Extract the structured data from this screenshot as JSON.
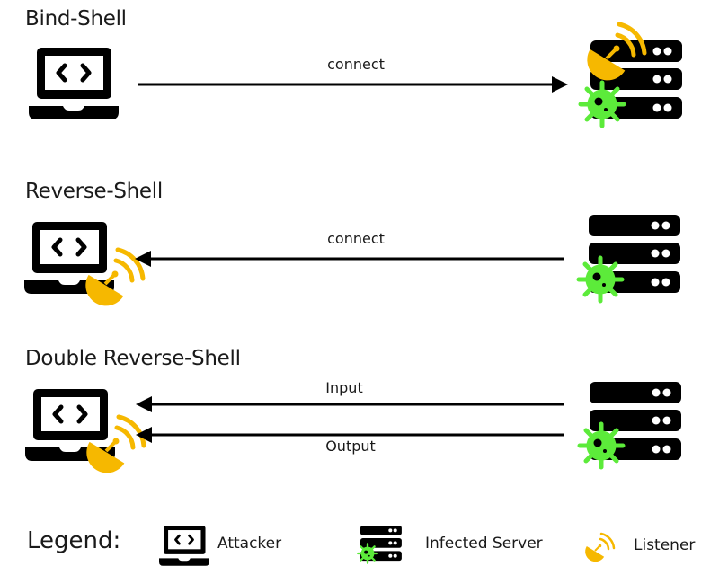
{
  "colors": {
    "ink": "#000000",
    "listener": "#F6B800",
    "infection": "#5CEB3A",
    "background": "#FFFFFF"
  },
  "sections": [
    {
      "title": "Bind-Shell",
      "arrows": [
        {
          "label": "connect",
          "direction": "attacker-to-server"
        }
      ],
      "attacker_has_listener": false,
      "server_has_listener": true
    },
    {
      "title": "Reverse-Shell",
      "arrows": [
        {
          "label": "connect",
          "direction": "server-to-attacker"
        }
      ],
      "attacker_has_listener": true,
      "server_has_listener": false
    },
    {
      "title": "Double Reverse-Shell",
      "arrows": [
        {
          "label": "Input",
          "direction": "server-to-attacker"
        },
        {
          "label": "Output",
          "direction": "server-to-attacker"
        }
      ],
      "attacker_has_listener": true,
      "server_has_listener": false
    }
  ],
  "legend": {
    "title": "Legend:",
    "items": [
      {
        "icon": "laptop-code-icon",
        "label": "Attacker"
      },
      {
        "icon": "infected-server-icon",
        "label": "Infected Server"
      },
      {
        "icon": "satellite-dish-icon",
        "label": "Listener"
      }
    ]
  }
}
